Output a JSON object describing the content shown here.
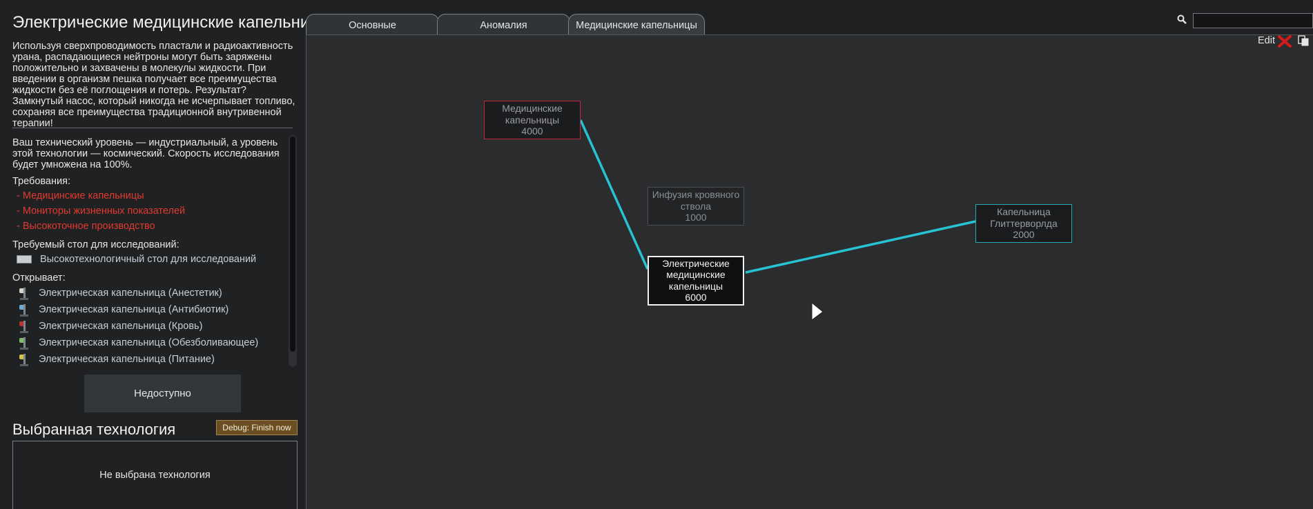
{
  "detail": {
    "title": "Электрические медицинские капельницы",
    "description": "Используя сверхпроводимость пластали и радиоактивность урана, распадающиеся нейтроны могут быть заряжены положительно и захвачены в молекулы жидкости. При введении в организм пешка получает все преимущества жидкости без её поглощения и потерь. Результат? Замкнутый насос, который никогда не исчерпывает топливо, сохраняя все преимущества традиционной внутривенной терапии!",
    "tech_level_info": "Ваш технический уровень — индустриальный, а уровень этой технологии — космический. Скорость исследования будет умножена на 100%.",
    "requirements_label": "Требования:",
    "requirements": [
      "- Медицинские капельницы",
      "- Мониторы жизненных показателей",
      "- Высокоточное производство"
    ],
    "bench_label": "Требуемый стол для исследований:",
    "bench": "Высокотехнологичный стол для исследований",
    "unlocks_label": "Открывает:",
    "unlocks": [
      "Электрическая капельница (Анестетик)",
      "Электрическая капельница (Антибиотик)",
      "Электрическая капельница (Кровь)",
      "Электрическая капельница (Обезболивающее)",
      "Электрическая капельница (Питание)"
    ],
    "unlock_icon_colors": [
      "#d8d4c8",
      "#6aa9d8",
      "#b8332e",
      "#7fbf6a",
      "#d6c04a"
    ],
    "status_button": "Недоступно"
  },
  "selected": {
    "title": "Выбранная технология",
    "debug_button": "Debug: Finish now",
    "empty_text": "Не выбрана технология"
  },
  "tabs": [
    "Основные",
    "Аномалия",
    "Медицинские капельницы"
  ],
  "active_tab": 2,
  "toolbar": {
    "search_placeholder": "",
    "edit_label": "Edit"
  },
  "nodes": {
    "medical": {
      "name": "Медицинские капельницы",
      "cost": "4000"
    },
    "bloodstem": {
      "name": "Инфузия кровяного ствола",
      "cost": "1000"
    },
    "electric": {
      "name": "Электрические медицинские капельницы",
      "cost": "6000"
    },
    "glitter": {
      "name": "Капельница Глиттерворлда",
      "cost": "2000"
    }
  },
  "colors": {
    "link": "#27c3d3",
    "missing_requirement": "#e23a2f",
    "debug_button": "#6b4f22"
  }
}
